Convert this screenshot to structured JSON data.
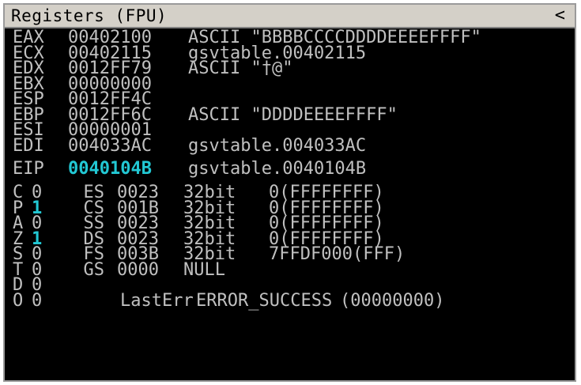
{
  "window": {
    "title": "Registers (FPU)",
    "collapse_glyph": "<"
  },
  "registers": [
    {
      "name": "EAX",
      "value": "00402100",
      "comment": "ASCII \"BBBBCCCCDDDDEEEEFFFF\""
    },
    {
      "name": "ECX",
      "value": "00402115",
      "comment": "gsvtable.00402115"
    },
    {
      "name": "EDX",
      "value": "0012FF79",
      "comment": "ASCII \"†@\""
    },
    {
      "name": "EBX",
      "value": "00000000",
      "comment": ""
    },
    {
      "name": "ESP",
      "value": "0012FF4C",
      "comment": ""
    },
    {
      "name": "EBP",
      "value": "0012FF6C",
      "comment": "ASCII \"DDDDEEEEFFFF\""
    },
    {
      "name": "ESI",
      "value": "00000001",
      "comment": ""
    },
    {
      "name": "EDI",
      "value": "004033AC",
      "comment": "gsvtable.004033AC"
    }
  ],
  "eip": {
    "name": "EIP",
    "value": "0040104B",
    "comment": "gsvtable.0040104B"
  },
  "flags": [
    {
      "name": "C",
      "value": "0",
      "segment": "ES",
      "seg_value": "0023",
      "bits": "32bit",
      "info": "0(FFFFFFFF)"
    },
    {
      "name": "P",
      "value": "1",
      "segment": "CS",
      "seg_value": "001B",
      "bits": "32bit",
      "info": "0(FFFFFFFF)"
    },
    {
      "name": "A",
      "value": "0",
      "segment": "SS",
      "seg_value": "0023",
      "bits": "32bit",
      "info": "0(FFFFFFFF)"
    },
    {
      "name": "Z",
      "value": "1",
      "segment": "DS",
      "seg_value": "0023",
      "bits": "32bit",
      "info": "0(FFFFFFFF)"
    },
    {
      "name": "S",
      "value": "0",
      "segment": "FS",
      "seg_value": "003B",
      "bits": "32bit",
      "info": "7FFDF000(FFF)"
    },
    {
      "name": "T",
      "value": "0",
      "segment": "GS",
      "seg_value": "0000",
      "bits": "NULL",
      "info": ""
    },
    {
      "name": "D",
      "value": "0",
      "segment": "",
      "seg_value": "",
      "bits": "",
      "info": ""
    },
    {
      "name": "O",
      "value": "0",
      "segment": "",
      "seg_value": "LastErr",
      "bits": "ERROR_SUCCESS",
      "info": "(00000000)"
    }
  ],
  "colors": {
    "background": "#000000",
    "text": "#c0c0c0",
    "highlight": "#22c8d4",
    "titlebar": "#d4d0c8"
  }
}
